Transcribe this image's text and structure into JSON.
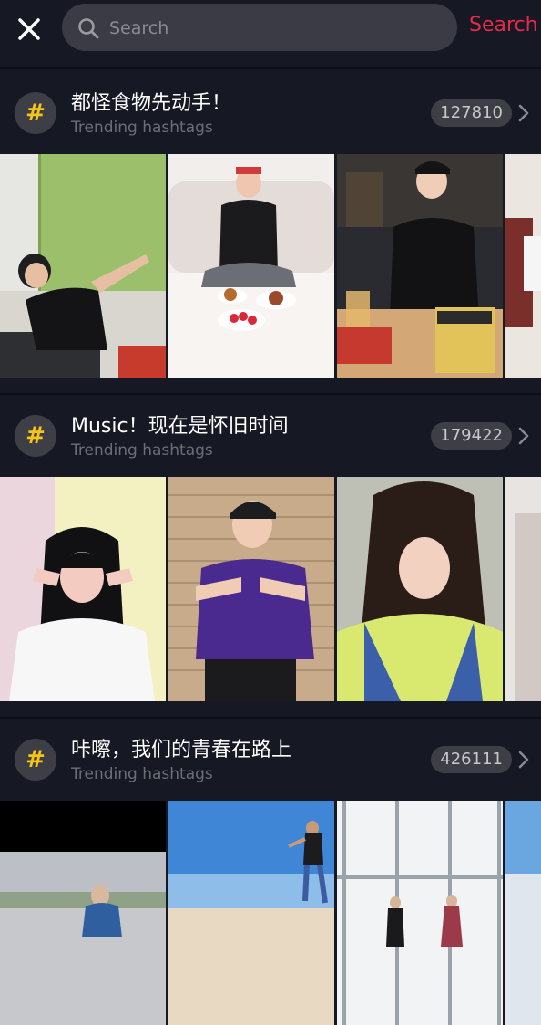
{
  "header": {
    "search_placeholder": "Search",
    "search_button": "Search"
  },
  "colors": {
    "background": "#161823",
    "accent": "#e5294a",
    "hashtag_icon": "#f5c518",
    "badge_bg": "#3d3e46"
  },
  "hashtags": [
    {
      "icon": "hashtag-icon",
      "title": "都怪食物先动手！",
      "subtitle": "Trending hashtags",
      "count": "127810"
    },
    {
      "icon": "hashtag-icon",
      "title": "Music！现在是怀旧时间",
      "subtitle": "Trending hashtags",
      "count": "179422"
    },
    {
      "icon": "hashtag-icon",
      "title": "咔嚓，我们的青春在路上",
      "subtitle": "Trending hashtags",
      "count": "426111"
    }
  ]
}
